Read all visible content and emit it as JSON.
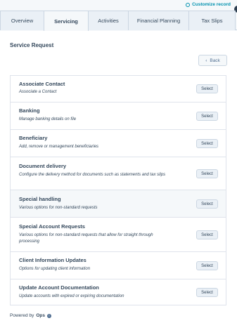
{
  "header": {
    "customize_label": "Customize record"
  },
  "tabs": [
    {
      "label": "Overview"
    },
    {
      "label": "Servicing"
    },
    {
      "label": "Activities"
    },
    {
      "label": "Financial Planning"
    },
    {
      "label": "Tax Slips"
    }
  ],
  "service_request": {
    "title": "Service Request",
    "back_label": "Back",
    "select_label": "Select",
    "items": [
      {
        "title": "Associate Contact",
        "description": "Associate a Contact"
      },
      {
        "title": "Banking",
        "description": "Manage banking details on file"
      },
      {
        "title": "Beneficiary",
        "description": "Add, remove or management beneficiaries"
      },
      {
        "title": "Document delivery",
        "description": "Configure the delivery method for documents such as statements and tax slips"
      },
      {
        "title": "Special handling",
        "description": "Various options for non-standard requests"
      },
      {
        "title": "Special Account Requests",
        "description": "Various options for non-standard requests that allow for straight through processing"
      },
      {
        "title": "Client Information Updates",
        "description": "Options for updating client information"
      },
      {
        "title": "Update Account Documentation",
        "description": "Update accounts with expired or expiring documentation"
      }
    ]
  },
  "footer": {
    "powered_prefix": "Powered by",
    "powered_brand": "Ops"
  }
}
